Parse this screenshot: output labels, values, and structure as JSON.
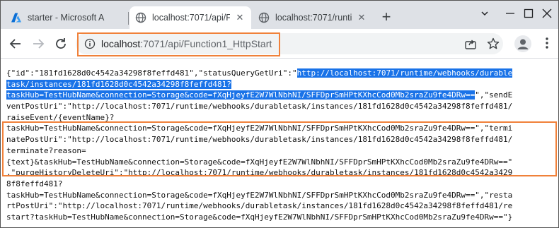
{
  "tabs": [
    {
      "title": "starter - Microsoft A",
      "icon": "azure-icon",
      "active": false
    },
    {
      "title": "localhost:7071/api/F",
      "icon": "globe-icon",
      "active": true
    },
    {
      "title": "localhost:7071/runti",
      "icon": "globe-icon",
      "active": false
    }
  ],
  "toolbar": {
    "url_host": "localhost",
    "url_path": ":7071/api/Function1_HttpStart"
  },
  "colors": {
    "highlight_border": "#f0813a",
    "selection": "#1a73e8",
    "tabstrip": "#dee1e6"
  },
  "content": {
    "lines": [
      {
        "plain": "{\"id\":\"181fd1628d0c4542a34298f8feffd481\",\"statusQueryGetUri\":\"",
        "selected": "http://localhost:7071/runtime/webhooks/durable",
        "after": ""
      },
      {
        "plain": "",
        "selected": "task/instances/181fd1628d0c4542a34298f8feffd481?",
        "after": ""
      },
      {
        "plain": "",
        "selected": "taskHub=TestHubName&connection=Storage&code=fXqHjeyfE2W7WlNbhNI/SFFDprSmHPtKXhcCod0Mb2sraZu9fe4DRw==",
        "after": "\",\"sendE"
      },
      {
        "plain": "ventPostUri\":\"http://localhost:7071/runtime/webhooks/durabletask/instances/181fd1628d0c4542a34298f8feffd481/",
        "selected": "",
        "after": ""
      },
      {
        "plain": "raiseEvent/{eventName}?",
        "selected": "",
        "after": ""
      },
      {
        "plain": "taskHub=TestHubName&connection=Storage&code=fXqHjeyfE2W7WlNbhNI/SFFDprSmHPtKXhcCod0Mb2sraZu9fe4DRw==\",\"termi",
        "selected": "",
        "after": ""
      },
      {
        "plain": "natePostUri\":\"http://localhost:7071/runtime/webhooks/durabletask/instances/181fd1628d0c4542a34298f8feffd481/",
        "selected": "",
        "after": ""
      },
      {
        "plain": "terminate?reason=",
        "selected": "",
        "after": ""
      },
      {
        "plain": "{text}&taskHub=TestHubName&connection=Storage&code=fXqHjeyfE2W7WlNbhNI/SFFDprSmHPtKXhcCod0Mb2sraZu9fe4DRw==\"",
        "selected": "",
        "after": ""
      },
      {
        "plain": ",\"purgeHistoryDeleteUri\":\"http://localhost:7071/runtime/webhooks/durabletask/instances/181fd1628d0c4542a3429",
        "selected": "",
        "after": ""
      },
      {
        "plain": "8f8feffd481?",
        "selected": "",
        "after": ""
      },
      {
        "plain": "taskHub=TestHubName&connection=Storage&code=fXqHjeyfE2W7WlNbhNI/SFFDprSmHPtKXhcCod0Mb2sraZu9fe4DRw==\",\"resta",
        "selected": "",
        "after": ""
      },
      {
        "plain": "rtPostUri\":\"http://localhost:7071/runtime/webhooks/durabletask/instances/181fd1628d0c4542a34298f8feffd481/re",
        "selected": "",
        "after": ""
      },
      {
        "plain": "start?taskHub=TestHubName&connection=Storage&code=fXqHjeyfE2W7WlNbhNI/SFFDprSmHPtKXhcCod0Mb2sraZu9fe4DRw==\"}",
        "selected": "",
        "after": ""
      }
    ]
  }
}
